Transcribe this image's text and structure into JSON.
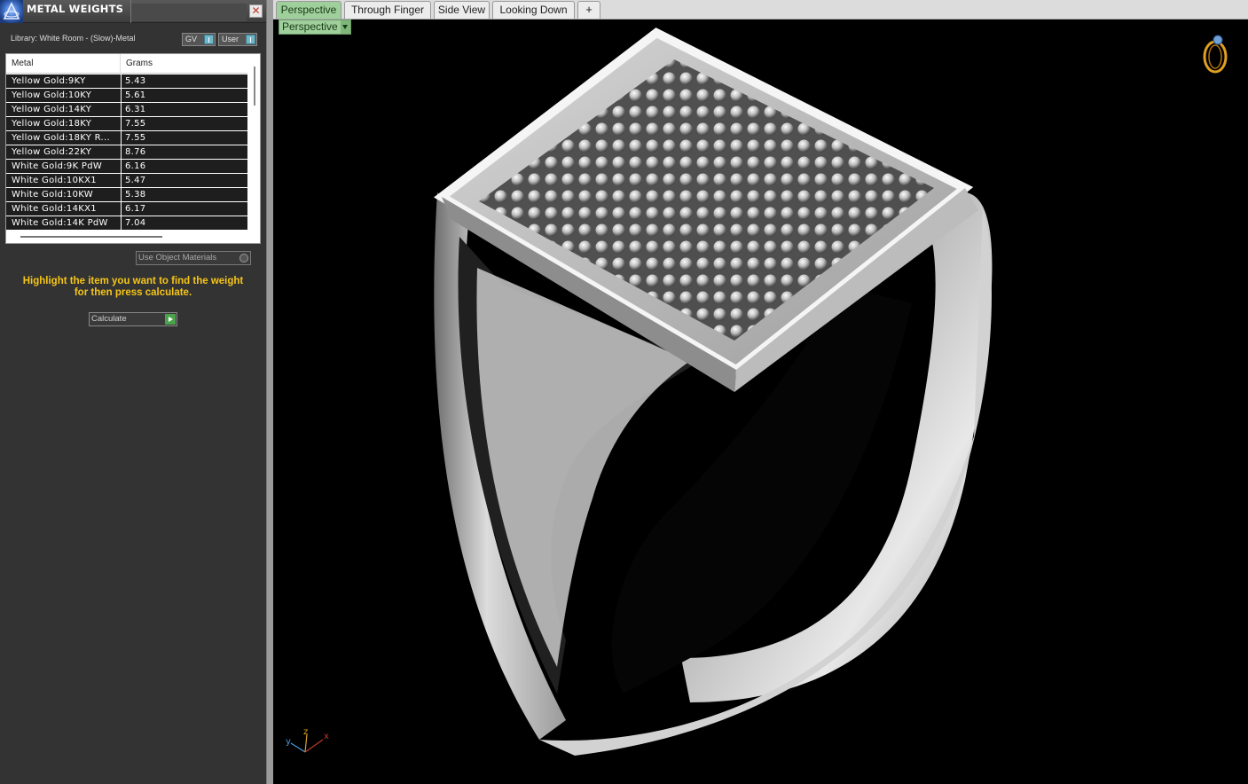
{
  "panel": {
    "title": "METAL WEIGHTS",
    "close_glyph": "✕",
    "library_label": "Library: White Room - (Slow)-Metal",
    "gv_label": "GV",
    "user_label": "User",
    "table": {
      "col_metal": "Metal",
      "col_grams": "Grams",
      "rows": [
        {
          "metal": "Yellow Gold:9KY",
          "grams": "5.43"
        },
        {
          "metal": "Yellow Gold:10KY",
          "grams": "5.61"
        },
        {
          "metal": "Yellow Gold:14KY",
          "grams": "6.31"
        },
        {
          "metal": "Yellow Gold:18KY",
          "grams": "7.55"
        },
        {
          "metal": "Yellow Gold:18KY R...",
          "grams": "7.55"
        },
        {
          "metal": "Yellow Gold:22KY",
          "grams": "8.76"
        },
        {
          "metal": "White Gold:9K PdW",
          "grams": "6.16"
        },
        {
          "metal": "White Gold:10KX1",
          "grams": "5.47"
        },
        {
          "metal": "White Gold:10KW",
          "grams": "5.38"
        },
        {
          "metal": "White Gold:14KX1",
          "grams": "6.17"
        },
        {
          "metal": "White Gold:14K PdW",
          "grams": "7.04"
        }
      ]
    },
    "use_object_materials_label": "Use Object Materials",
    "instructions_line1": "Highlight the item you want to find the weight",
    "instructions_line2": "for then press calculate.",
    "calculate_label": "Calculate"
  },
  "tabs": [
    {
      "label": "Perspective",
      "active": true
    },
    {
      "label": "Through Finger",
      "active": false
    },
    {
      "label": "Side View",
      "active": false
    },
    {
      "label": "Looking Down",
      "active": false
    },
    {
      "label": "+",
      "active": false
    }
  ],
  "viewport": {
    "view_dropdown_label": "Perspective",
    "axis_labels": {
      "x": "x",
      "y": "y",
      "z": "z"
    }
  },
  "icons": {
    "app_logo": "rhino-logo-icon",
    "close": "close-icon",
    "add_tab": "plus-icon",
    "ring_gizmo": "ring-view-icon",
    "axis_gizmo": "axis-triad-icon"
  },
  "colors": {
    "accent_tab": "#9fcf9a",
    "instruction_text": "#f5c518",
    "panel_bg": "#333333",
    "viewport_bg": "#000000"
  }
}
